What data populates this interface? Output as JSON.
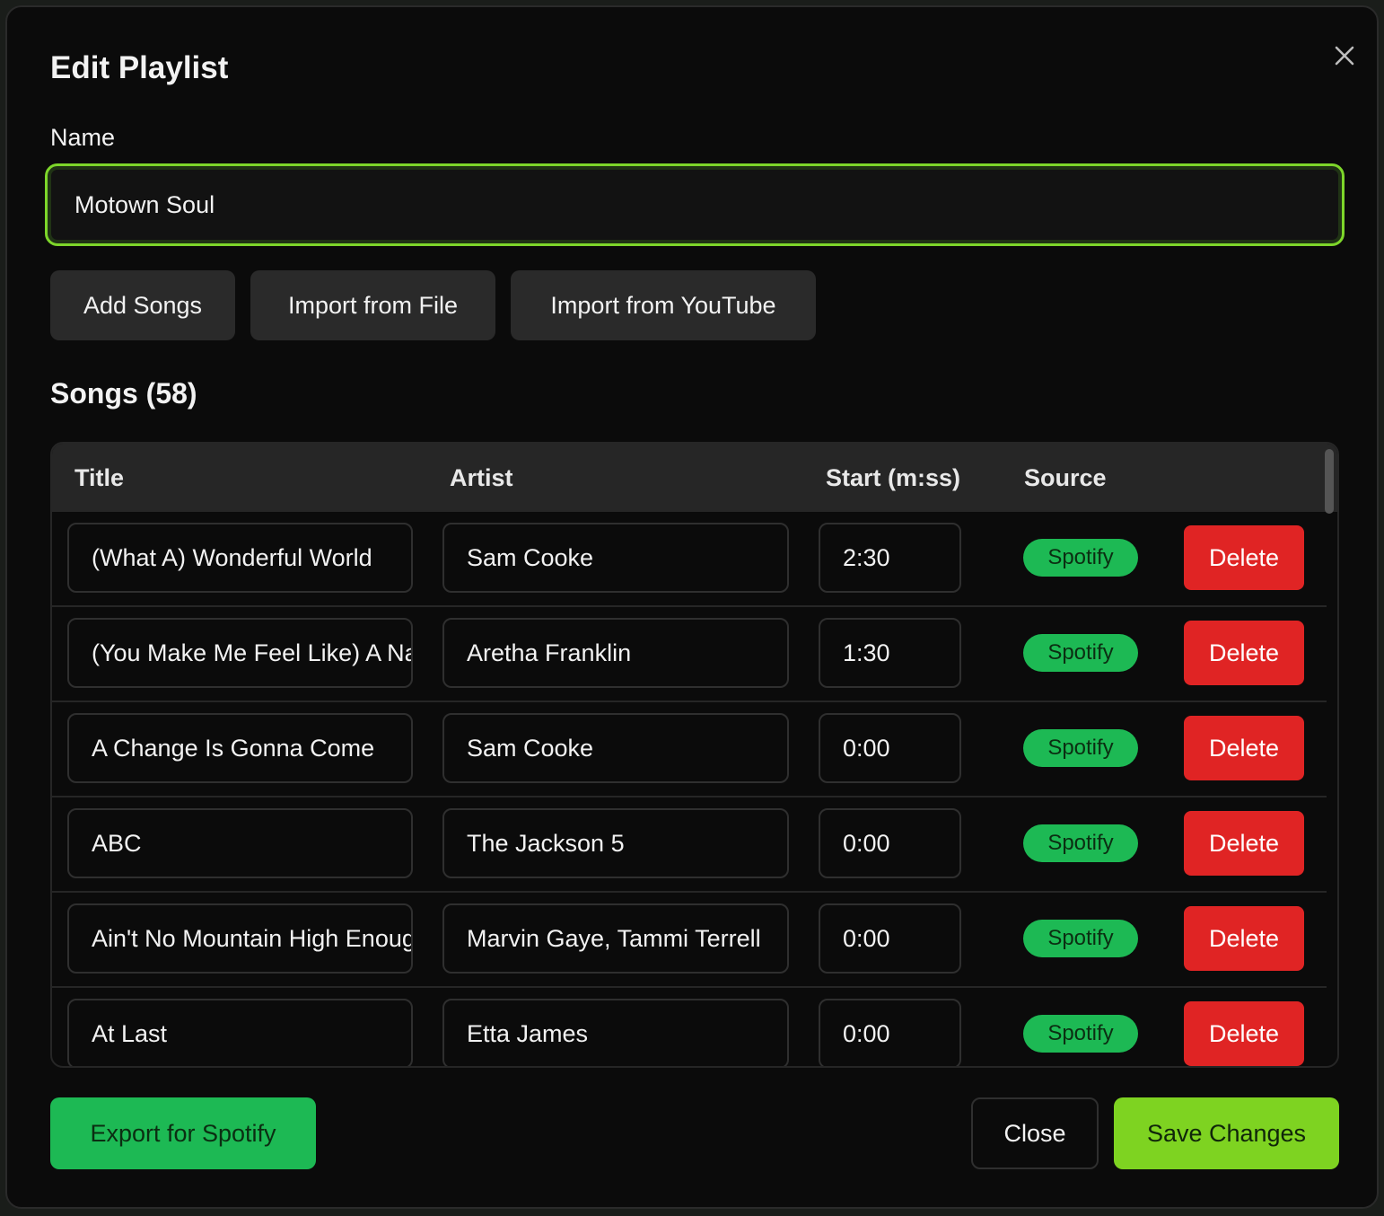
{
  "dialog": {
    "title": "Edit Playlist",
    "name_label": "Name",
    "name_value": "Motown Soul"
  },
  "actions": {
    "add_songs": "Add Songs",
    "import_file": "Import from File",
    "import_youtube": "Import from YouTube"
  },
  "songs": {
    "heading": "Songs (58)",
    "columns": {
      "title": "Title",
      "artist": "Artist",
      "start": "Start (m:ss)",
      "source": "Source"
    },
    "delete_label": "Delete",
    "rows": [
      {
        "title": "(What A) Wonderful World",
        "artist": "Sam Cooke",
        "start": "2:30",
        "source": "Spotify"
      },
      {
        "title": "(You Make Me Feel Like) A Natural Woman",
        "artist": "Aretha Franklin",
        "start": "1:30",
        "source": "Spotify"
      },
      {
        "title": "A Change Is Gonna Come",
        "artist": "Sam Cooke",
        "start": "0:00",
        "source": "Spotify"
      },
      {
        "title": "ABC",
        "artist": "The Jackson 5",
        "start": "0:00",
        "source": "Spotify"
      },
      {
        "title": "Ain't No Mountain High Enough",
        "artist": "Marvin Gaye, Tammi Terrell",
        "start": "0:00",
        "source": "Spotify"
      },
      {
        "title": "At Last",
        "artist": "Etta James",
        "start": "0:00",
        "source": "Spotify"
      }
    ]
  },
  "footer": {
    "export": "Export for Spotify",
    "close": "Close",
    "save": "Save Changes"
  },
  "colors": {
    "accent_green": "#7ed321",
    "spotify_green": "#1db954",
    "danger_red": "#e02424"
  },
  "icons": {
    "close": "close-icon"
  }
}
